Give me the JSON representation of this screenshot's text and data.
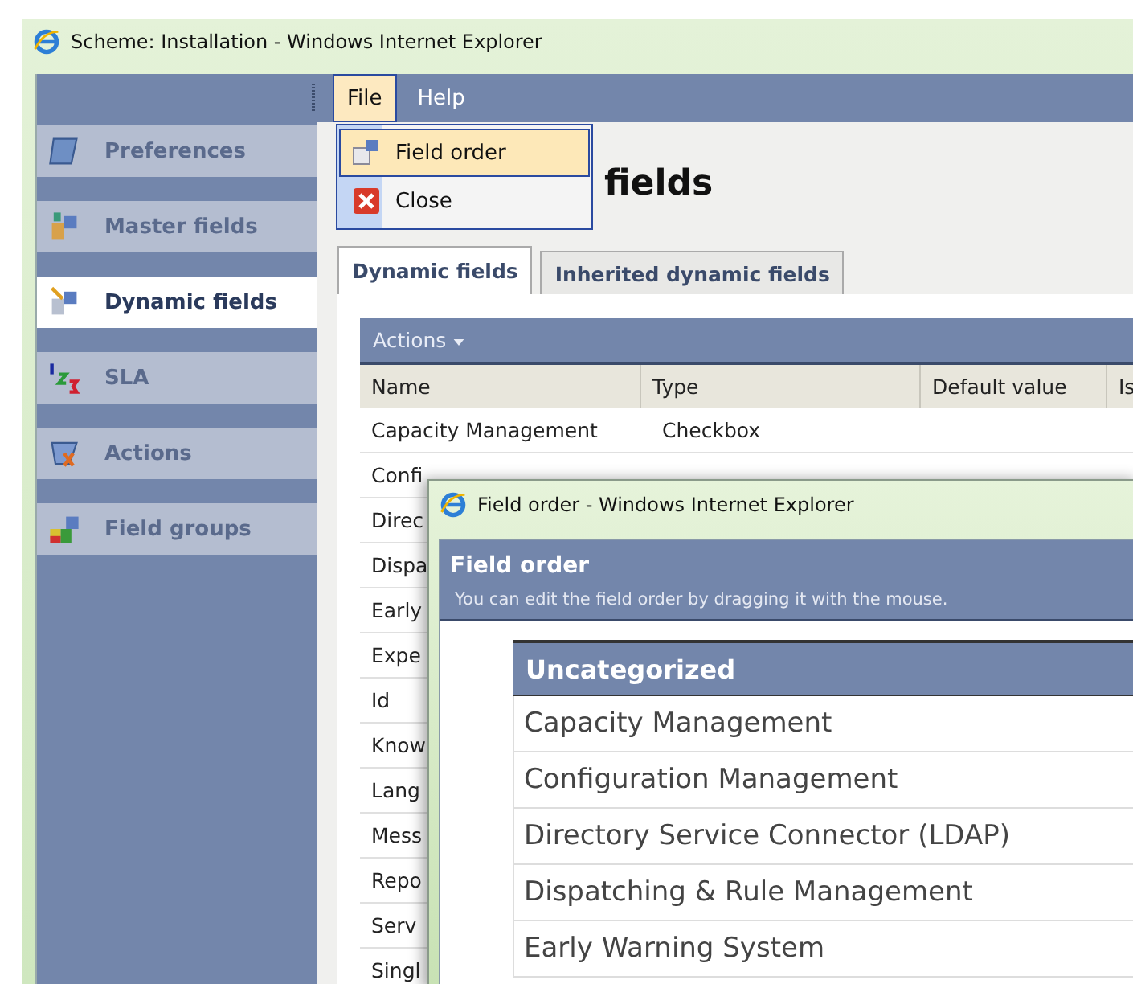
{
  "window": {
    "title": "Scheme: Installation - Windows Internet Explorer"
  },
  "menubar": [
    {
      "label": "File",
      "selected": true
    },
    {
      "label": "Help",
      "selected": false
    }
  ],
  "file_menu": [
    {
      "label": "Field order",
      "kind": "order",
      "selected": true
    },
    {
      "label": "Close",
      "kind": "close",
      "selected": false
    }
  ],
  "sidebar": {
    "items": [
      {
        "label": "Preferences",
        "kind": "preferences",
        "selected": false
      },
      {
        "label": "Master fields",
        "kind": "master",
        "selected": false
      },
      {
        "label": "Dynamic fields",
        "kind": "dynamic",
        "selected": true
      },
      {
        "label": "SLA",
        "kind": "sla",
        "selected": false
      },
      {
        "label": "Actions",
        "kind": "actions",
        "selected": false
      },
      {
        "label": "Field groups",
        "kind": "groups",
        "selected": false
      }
    ]
  },
  "heading": "fields",
  "tabs": [
    {
      "label": "Dynamic fields",
      "selected": true
    },
    {
      "label": "Inherited dynamic fields",
      "selected": false
    }
  ],
  "toolbar": {
    "actions": "Actions"
  },
  "table": {
    "columns": [
      "Name",
      "Type",
      "Default value",
      "Is"
    ],
    "rows": [
      [
        "Capacity Management",
        "Checkbox"
      ],
      [
        "Confi"
      ],
      [
        "Direc"
      ],
      [
        "Dispa"
      ],
      [
        "Early"
      ],
      [
        "Expe"
      ],
      [
        "Id"
      ],
      [
        "Know"
      ],
      [
        "Lang"
      ],
      [
        "Mess"
      ],
      [
        "Repo"
      ],
      [
        "Serv"
      ],
      [
        "Singl"
      ]
    ]
  },
  "popup": {
    "title": "Field order - Windows Internet Explorer",
    "heading": "Field order",
    "description": "You can edit the field order by dragging it with the mouse.",
    "group_title": "Uncategorized",
    "items": [
      "Capacity Management",
      "Configuration Management",
      "Directory Service Connector (LDAP)",
      "Dispatching & Rule Management",
      "Early Warning System"
    ]
  }
}
